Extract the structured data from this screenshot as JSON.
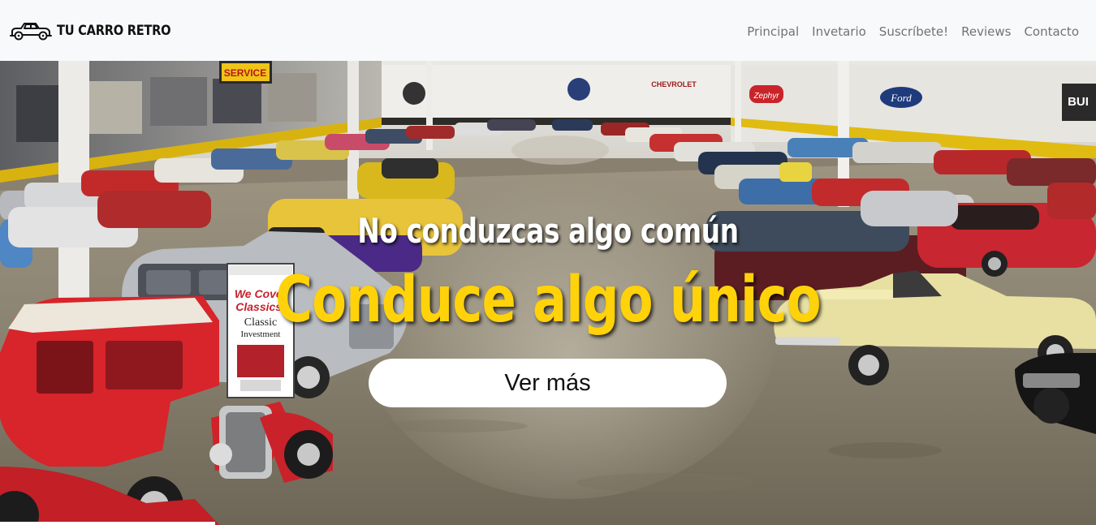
{
  "navbar": {
    "brand": "TU CARRO RETRO",
    "brand_icon": "vintage-car-icon",
    "links": [
      "Principal",
      "Invetario",
      "Suscríbete!",
      "Reviews",
      "Contacto"
    ]
  },
  "hero": {
    "headline": "No conduzcas algo común",
    "tagline": "Conduce algo único",
    "button_label": "Ver más",
    "photo_signs": {
      "service": "SERVICE",
      "promo_line1": "We Cover",
      "promo_line2": "Classics!",
      "promo_line3": "Classic",
      "promo_line4": "Investment",
      "zephyr": "Zephyr",
      "ford": "Ford",
      "chevrolet": "CHEVROLET",
      "buick": "BUI"
    },
    "colors": {
      "tagline": "#ffd20a",
      "headline": "#ffffff",
      "button_bg": "#ffffff"
    }
  }
}
